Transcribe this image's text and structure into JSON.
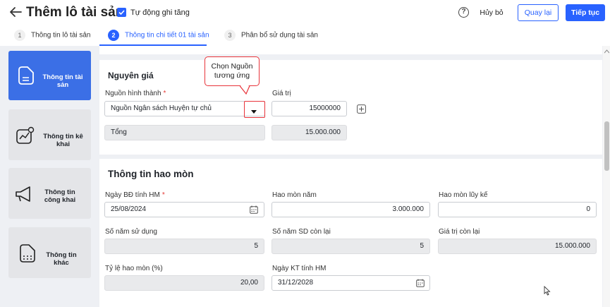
{
  "header": {
    "title": "Thêm lô tài sản",
    "auto_increase_label": "Tự động ghi tăng",
    "help": "?",
    "cancel_label": "Hủy bỏ",
    "back_label": "Quay lại",
    "next_label": "Tiếp tục"
  },
  "steps": [
    {
      "num": "1",
      "label": "Thông tin lô tài sản"
    },
    {
      "num": "2",
      "label": "Thông tin chi tiết 01 tài sản"
    },
    {
      "num": "3",
      "label": "Phân bổ sử dụng tài sản"
    }
  ],
  "sidebar": {
    "items": [
      {
        "label": "Thông tin tài sản",
        "icon": "document-icon"
      },
      {
        "label": "Thông tin kê khai",
        "icon": "chart-icon"
      },
      {
        "label": "Thông tin công khai",
        "icon": "megaphone-icon"
      },
      {
        "label": "Thông tin khác",
        "icon": "folder-icon"
      }
    ]
  },
  "original_price": {
    "title": "Nguyên giá",
    "source_label": "Nguồn hình thành",
    "source_value": "Nguồn Ngân sách Huyện tự chủ",
    "value_label": "Giá trị",
    "value": "15000000",
    "total_label": "Tổng",
    "total_value": "15.000.000"
  },
  "callout": {
    "line1": "Chọn Nguồn",
    "line2": "tương ứng"
  },
  "depreciation": {
    "title": "Thông tin hao mòn",
    "start_date_label": "Ngày BĐ tính HM",
    "start_date": "25/08/2024",
    "annual_label": "Hao mòn năm",
    "annual_value": "3.000.000",
    "accumulated_label": "Hao mòn lũy kế",
    "accumulated_value": "0",
    "years_label": "Số năm sử dụng",
    "years_value": "5",
    "remaining_years_label": "Số năm SD còn lại",
    "remaining_years_value": "5",
    "remaining_value_label": "Giá trị còn lại",
    "remaining_value": "15.000.000",
    "rate_label": "Tỷ lệ hao mòn (%)",
    "rate_value": "20,00",
    "end_date_label": "Ngày KT tính HM",
    "end_date": "31/12/2028"
  },
  "colors": {
    "accent": "#2962ff",
    "sidebar_active": "#3b6fe6",
    "callout_border": "#e8333a",
    "required": "#e53935"
  }
}
